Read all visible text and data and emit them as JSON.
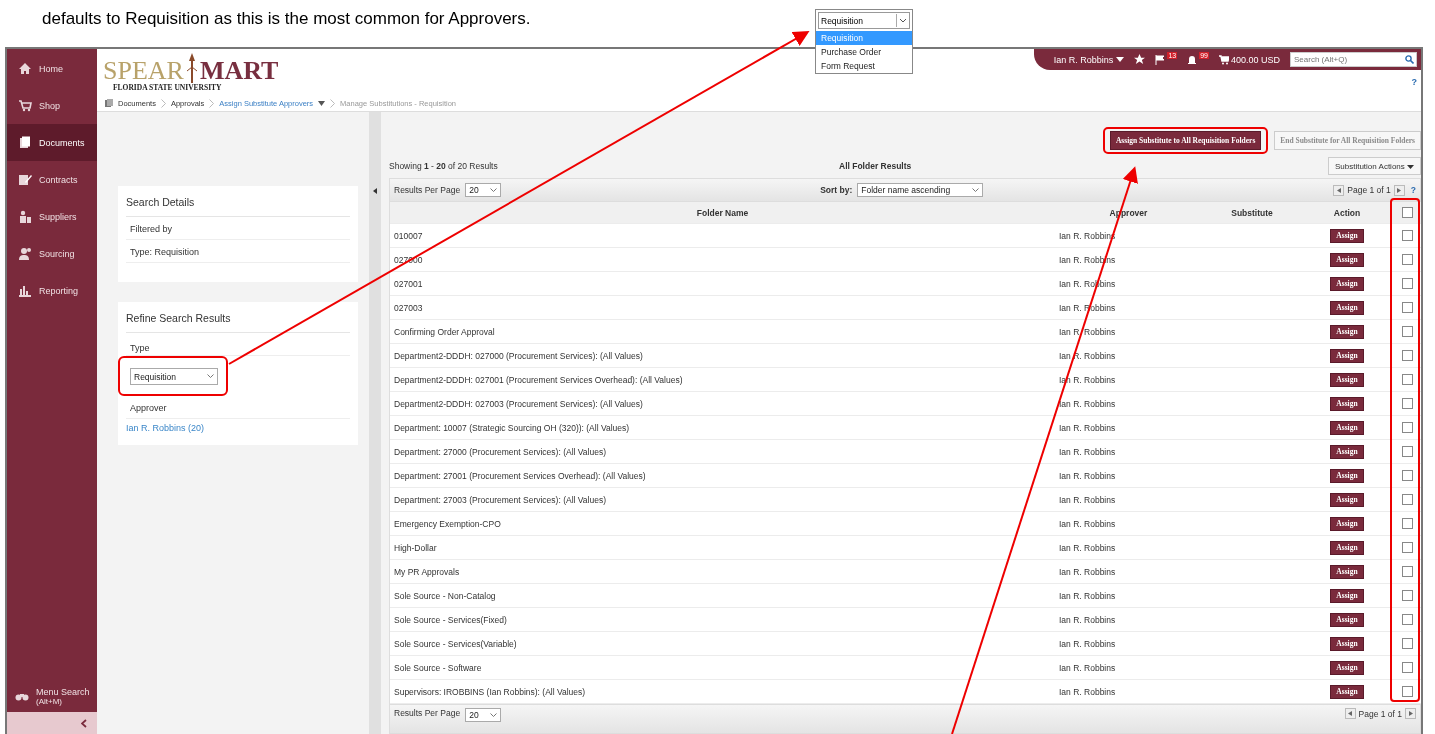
{
  "caption": "defaults to Requisition as this is the most common for Approvers.",
  "dropdown_inset": {
    "value": "Requisition",
    "options": [
      {
        "label": "Requisition",
        "selected": true
      },
      {
        "label": "Purchase Order",
        "selected": false
      },
      {
        "label": "Form Request",
        "selected": false
      }
    ]
  },
  "sidebar": {
    "items": [
      {
        "label": "Home",
        "selected": false
      },
      {
        "label": "Shop",
        "selected": false
      },
      {
        "label": "Documents",
        "selected": true
      },
      {
        "label": "Contracts",
        "selected": false
      },
      {
        "label": "Suppliers",
        "selected": false
      },
      {
        "label": "Sourcing",
        "selected": false
      },
      {
        "label": "Reporting",
        "selected": false
      }
    ],
    "menu_search": {
      "label": "Menu Search",
      "shortcut": "(Alt+M)"
    }
  },
  "logo": {
    "left": "SPEAR",
    "right": "MART",
    "subtitle": "FLORIDA STATE UNIVERSITY"
  },
  "breadcrumbs": [
    {
      "label": "Documents",
      "kind": "link"
    },
    {
      "label": "Approvals",
      "kind": "link"
    },
    {
      "label": "Assign Substitute Approvers",
      "kind": "menu"
    },
    {
      "label": "Manage Substitutions - Requisition",
      "kind": "current"
    }
  ],
  "user_bar": {
    "user": "Ian R. Robbins",
    "flag_count": "13",
    "bell_count": "99",
    "cart_total": "400.00 USD",
    "search": {
      "placeholder": "Search (Alt+Q)"
    },
    "help": "?"
  },
  "bulk_buttons": [
    {
      "label": "Assign Substitute to All Requisition Folders",
      "disabled": false
    },
    {
      "label": "End Substitute for All Requisition Folders",
      "disabled": true
    }
  ],
  "search_details": {
    "title": "Search Details",
    "rows": [
      "Filtered by",
      "Type: Requisition"
    ]
  },
  "refine": {
    "title": "Refine Search Results",
    "type_label": "Type",
    "type_value": "Requisition",
    "approver_label": "Approver",
    "approver_link": "Ian R. Robbins (20)"
  },
  "results": {
    "showing": "Showing **1** - **20** of 20 Results",
    "title": "All Folder Results",
    "actions_button": "Substitution Actions",
    "per_page_label": "Results Per Page",
    "per_page": "20",
    "sort_label": "Sort by:",
    "sort_value": "Folder name ascending",
    "pagination": "Page 1 of 1",
    "help": "?",
    "columns": [
      "Folder Name",
      "Approver",
      "Substitute",
      "Action"
    ],
    "select_all": false,
    "rows": [
      {
        "folder": "010007",
        "approver": "Ian R. Robbins",
        "action": "Assign",
        "checked": false
      },
      {
        "folder": "027000",
        "approver": "Ian R. Robbins",
        "action": "Assign",
        "checked": false
      },
      {
        "folder": "027001",
        "approver": "Ian R. Robbins",
        "action": "Assign",
        "checked": false
      },
      {
        "folder": "027003",
        "approver": "Ian R. Robbins",
        "action": "Assign",
        "checked": false
      },
      {
        "folder": "Confirming Order Approval",
        "approver": "Ian R. Robbins",
        "action": "Assign",
        "checked": false
      },
      {
        "folder": "Department2-DDDH: 027000 (Procurement Services): (All Values)",
        "approver": "Ian R. Robbins",
        "action": "Assign",
        "checked": false
      },
      {
        "folder": "Department2-DDDH: 027001 (Procurement Services Overhead): (All Values)",
        "approver": "Ian R. Robbins",
        "action": "Assign",
        "checked": false
      },
      {
        "folder": "Department2-DDDH: 027003 (Procurement Services): (All Values)",
        "approver": "Ian R. Robbins",
        "action": "Assign",
        "checked": false
      },
      {
        "folder": "Department: 10007 (Strategic Sourcing OH (320)): (All Values)",
        "approver": "Ian R. Robbins",
        "action": "Assign",
        "checked": false
      },
      {
        "folder": "Department: 27000 (Procurement Services): (All Values)",
        "approver": "Ian R. Robbins",
        "action": "Assign",
        "checked": false
      },
      {
        "folder": "Department: 27001 (Procurement Services Overhead): (All Values)",
        "approver": "Ian R. Robbins",
        "action": "Assign",
        "checked": false
      },
      {
        "folder": "Department: 27003 (Procurement Services): (All Values)",
        "approver": "Ian R. Robbins",
        "action": "Assign",
        "checked": false
      },
      {
        "folder": "Emergency Exemption-CPO",
        "approver": "Ian R. Robbins",
        "action": "Assign",
        "checked": false
      },
      {
        "folder": "High-Dollar",
        "approver": "Ian R. Robbins",
        "action": "Assign",
        "checked": false
      },
      {
        "folder": "My PR Approvals",
        "approver": "Ian R. Robbins",
        "action": "Assign",
        "checked": false
      },
      {
        "folder": "Sole Source - Non-Catalog",
        "approver": "Ian R. Robbins",
        "action": "Assign",
        "checked": false
      },
      {
        "folder": "Sole Source - Services(Fixed)",
        "approver": "Ian R. Robbins",
        "action": "Assign",
        "checked": false
      },
      {
        "folder": "Sole Source - Services(Variable)",
        "approver": "Ian R. Robbins",
        "action": "Assign",
        "checked": false
      },
      {
        "folder": "Sole Source - Software",
        "approver": "Ian R. Robbins",
        "action": "Assign",
        "checked": false
      },
      {
        "folder": "Supervisors: IROBBINS (Ian Robbins): (All Values)",
        "approver": "Ian R. Robbins",
        "action": "Assign",
        "checked": false
      }
    ],
    "footer": {
      "per_page_label": "Results Per Page",
      "per_page": "20",
      "pagination": "Page 1 of 1"
    }
  }
}
